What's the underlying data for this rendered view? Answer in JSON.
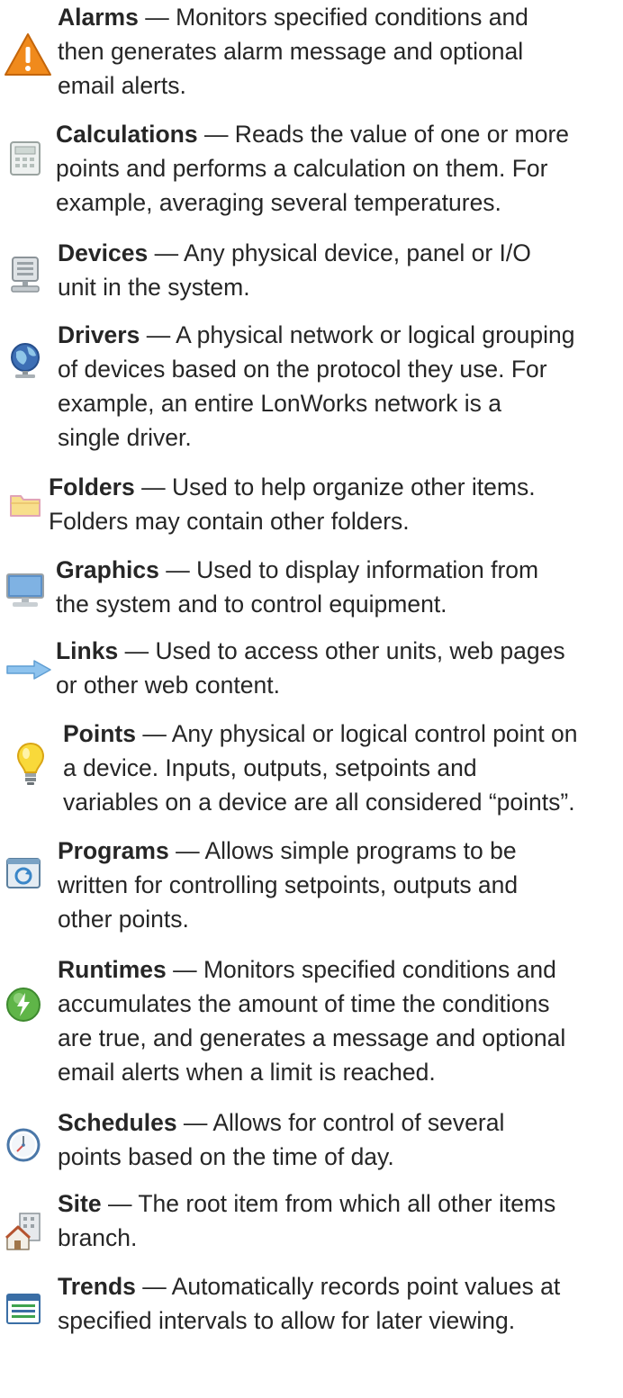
{
  "entries": [
    {
      "icon": "alarm-warning-icon",
      "term": "Alarms",
      "lines": [
        " — Monitors specified conditions and",
        "then generates alarm message and optional",
        "email alerts."
      ]
    },
    {
      "icon": "calculator-icon",
      "term": "Calculations",
      "lines": [
        " — Reads the value of one or more",
        "points and performs a calculation on them.  For",
        "example, averaging several temperatures."
      ]
    },
    {
      "icon": "device-icon",
      "term": "Devices",
      "lines": [
        " — Any physical device, panel or I/O",
        "unit in the system."
      ]
    },
    {
      "icon": "network-globe-icon",
      "term": "Drivers",
      "lines": [
        " — A physical network or logical grouping",
        "of devices based on the protocol they use.  For",
        "example, an entire LonWorks network is a",
        "single driver."
      ]
    },
    {
      "icon": "folder-icon",
      "term": "Folders",
      "lines": [
        " — Used to help organize other items.",
        "Folders may contain other folders."
      ]
    },
    {
      "icon": "monitor-icon",
      "term": "Graphics",
      "lines": [
        " — Used to display information from",
        "the system and to control equipment."
      ]
    },
    {
      "icon": "arrow-link-icon",
      "term": "Links",
      "lines": [
        " — Used to access other units, web pages",
        "or other web content."
      ]
    },
    {
      "icon": "light-bulb-icon",
      "term": "Points",
      "lines": [
        " — Any physical or logical control point on",
        "a device.  Inputs, outputs, setpoints and",
        "variables on a device are all considered “points”."
      ]
    },
    {
      "icon": "program-icon",
      "term": "Programs",
      "lines": [
        " — Allows simple programs to be",
        "written for controlling setpoints, outputs and",
        "other points."
      ]
    },
    {
      "icon": "runtime-lightning-icon",
      "term": "Runtimes",
      "lines": [
        " — Monitors specified conditions and",
        "accumulates the amount of time the conditions",
        "are true, and generates a message and optional",
        "email alerts when a limit is reached."
      ]
    },
    {
      "icon": "clock-icon",
      "term": "Schedules",
      "lines": [
        " — Allows for control of several",
        "points based on the time of day."
      ]
    },
    {
      "icon": "site-house-icon",
      "term": "Site",
      "lines": [
        " — The root item from which all other items",
        "branch."
      ]
    },
    {
      "icon": "trend-log-icon",
      "term": "Trends",
      "lines": [
        " — Automatically records point values at",
        "specified intervals to allow for later viewing."
      ]
    }
  ]
}
